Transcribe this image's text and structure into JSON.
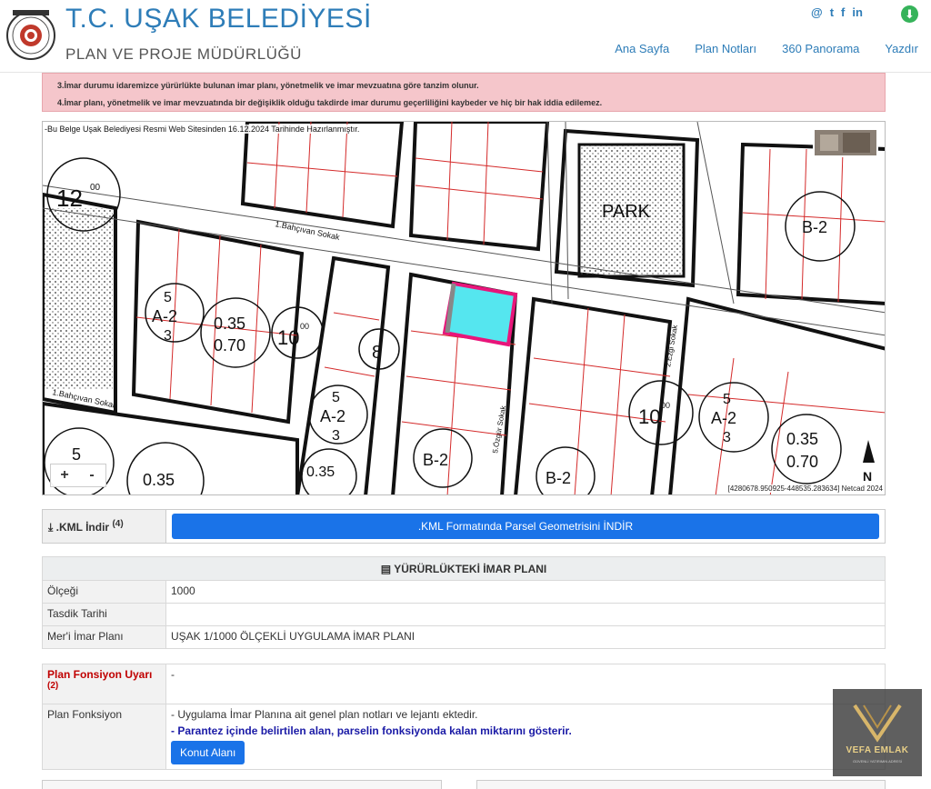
{
  "header": {
    "title": "T.C. UŞAK BELEDİYESİ",
    "subtitle": "PLAN VE PROJE MÜDÜRLÜĞÜ",
    "social": [
      "@",
      "t",
      "f",
      "in"
    ],
    "nav": [
      "Ana Sayfa",
      "Plan Notları",
      "360 Panorama",
      "Yazdır"
    ]
  },
  "warning": {
    "line3": "3.İmar durumu idaremizce yürürlükte bulunan imar planı, yönetmelik ve imar mevzuatına göre tanzim olunur.",
    "line4": "4.İmar planı, yönetmelik ve imar mevzuatında bir değişiklik olduğu takdirde imar durumu geçerliliğini kaybeder ve hiç bir hak iddia edilemez."
  },
  "map": {
    "note": "-Bu Belge Uşak Belediyesi Resmi Web Sitesinden 16.12.2024 Tarihinde Hazırlanmıştır.",
    "coords": "[4280678.950925-448535.283634] Netcad 2024",
    "zoom_in": "+",
    "zoom_out": "-",
    "labels": {
      "park": "PARK",
      "street1": "1.Bahçıvan Sokak",
      "street2": "1.Bahçıvan Sokak",
      "street3": "5.Özgür Sokak",
      "street4": "2.Ezgi Sokak",
      "h12": "12",
      "h12sup": "00",
      "h10a": "10",
      "h10sup": "00",
      "h10b": "10",
      "h8": "8",
      "ratio1": "0.35",
      "ratio2": "0.70",
      "b2": "B-2",
      "a2": "A-2",
      "five": "5",
      "three": "3",
      "north": "N"
    }
  },
  "kml": {
    "label": ".KML İndir",
    "label_note": "(4)",
    "button": ".KML Formatında Parsel Geometrisini İNDİR"
  },
  "plan_table": {
    "title": "YÜRÜRLÜKTEKİ İMAR PLANI",
    "rows": [
      {
        "label": "Ölçeği",
        "value": "1000"
      },
      {
        "label": "Tasdik Tarihi",
        "value": ""
      },
      {
        "label": "Mer'i İmar Planı",
        "value": "UŞAK 1/1000 ÖLÇEKLİ UYGULAMA İMAR PLANI"
      }
    ]
  },
  "function_table": {
    "warning_label": "Plan Fonsiyon Uyarı",
    "warning_note": "(2)",
    "warning_value": "-",
    "function_label": "Plan Fonksiyon",
    "function_value": "- Uygulama İmar Planına ait genel plan notları ve lejantı ektedir.",
    "function_note": "- Parantez içinde belirtilen alan, parselin fonksiyonda kalan miktarını gösterir.",
    "button": "Konut Alanı"
  },
  "watermark": {
    "name": "VEFA EMLAK",
    "sub": "GÜVENLİ YATIRIMIN ADRESİ"
  },
  "colors": {
    "accent": "#2e7db8",
    "button": "#1a73e8",
    "warning_bg": "#f5c6cb",
    "parcel_fill": "#55e6ef",
    "parcel_border": "#e8157a"
  }
}
